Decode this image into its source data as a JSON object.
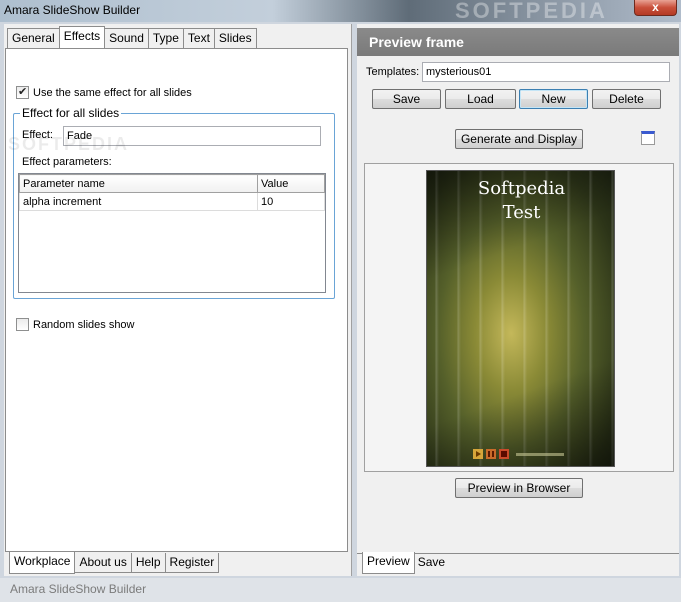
{
  "window": {
    "title": "Amara SlideShow Builder",
    "watermark": "SOFTPEDIA",
    "close_label": "x"
  },
  "left": {
    "tabs": [
      "General",
      "Effects",
      "Sound",
      "Type",
      "Text",
      "Slides"
    ],
    "active_tab": "Effects",
    "same_effect_label": "Use the same effect for all slides",
    "same_effect_checked": true,
    "group_label": "Effect for all slides",
    "effect_label": "Effect:",
    "effect_value": "Fade",
    "params_label": "Effect parameters:",
    "params_watermark": "SOFTPEDIA",
    "table": {
      "headers": [
        "Parameter name",
        "Value"
      ],
      "rows": [
        [
          "alpha increment",
          "10"
        ]
      ]
    },
    "random_label": "Random slides show",
    "random_checked": false,
    "bottom_tabs": [
      "Workplace",
      "About us",
      "Help",
      "Register"
    ]
  },
  "right": {
    "header": "Preview frame",
    "templates_label": "Templates:",
    "templates_value": "mysterious01",
    "buttons": {
      "save": "Save",
      "load": "Load",
      "new": "New",
      "delete": "Delete",
      "generate": "Generate and Display",
      "preview_browser": "Preview in Browser"
    },
    "slide_text_line1": "Softpedia",
    "slide_text_line2": "Test",
    "bottom_tabs": [
      "Preview",
      "Save"
    ]
  },
  "status": "Amara SlideShow Builder"
}
